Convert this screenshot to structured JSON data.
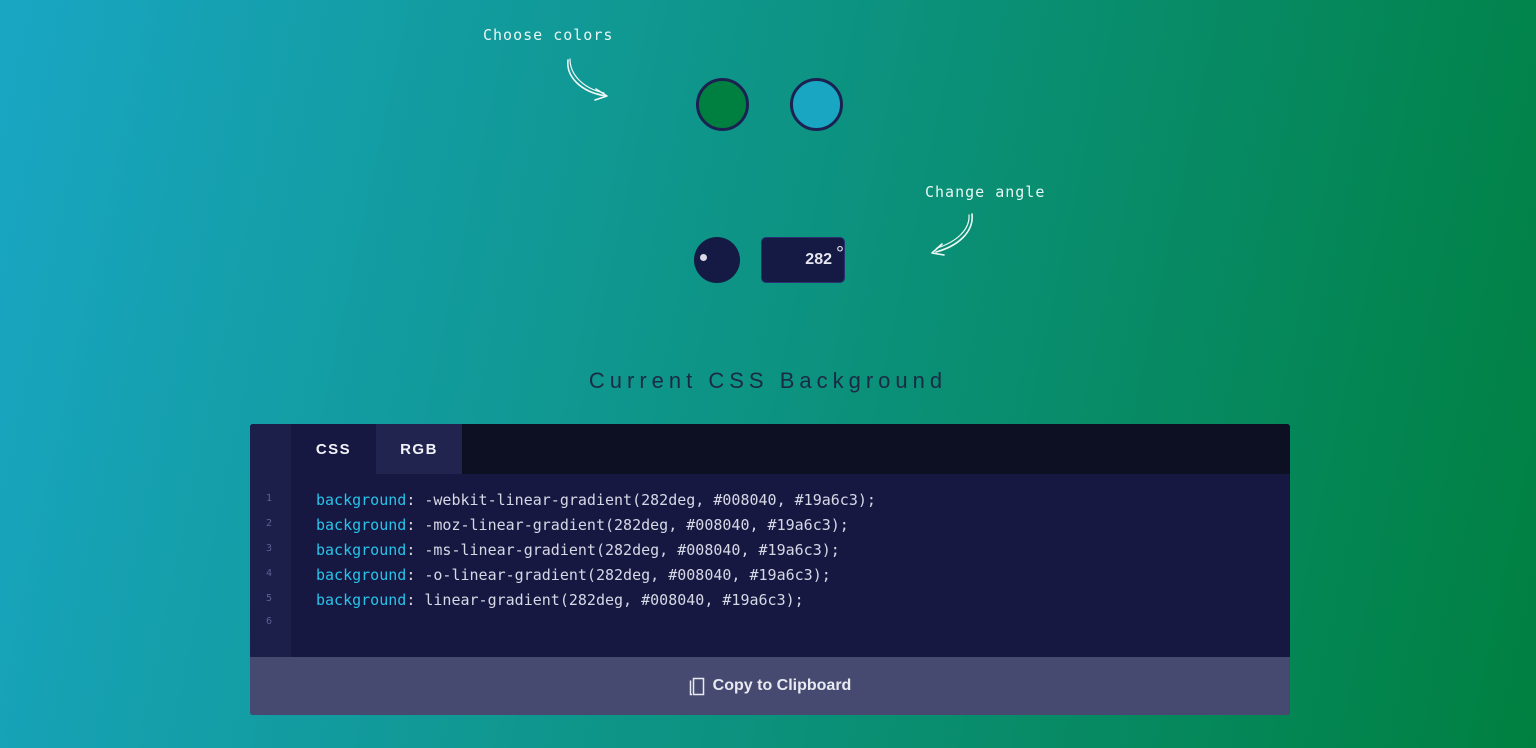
{
  "hints": {
    "choose_colors": "Choose colors",
    "change_angle": "Change angle"
  },
  "colors": {
    "first": "#008040",
    "second": "#19a6c3"
  },
  "angle": {
    "value": "282",
    "unit": "°"
  },
  "section_title": "Current CSS Background",
  "tabs": [
    {
      "label": "CSS",
      "active": true
    },
    {
      "label": "RGB",
      "active": false
    }
  ],
  "code": {
    "line_numbers": [
      "1",
      "2",
      "3",
      "4",
      "5",
      "6"
    ],
    "lines": [
      {
        "prop": "background",
        "value": ": -webkit-linear-gradient(282deg, #008040, #19a6c3);"
      },
      {
        "prop": "background",
        "value": ": -moz-linear-gradient(282deg, #008040, #19a6c3);"
      },
      {
        "prop": "background",
        "value": ": -ms-linear-gradient(282deg, #008040, #19a6c3);"
      },
      {
        "prop": "background",
        "value": ": -o-linear-gradient(282deg, #008040, #19a6c3);"
      },
      {
        "prop": "background",
        "value": ": linear-gradient(282deg, #008040, #19a6c3);"
      }
    ]
  },
  "copy_button": {
    "label": "Copy to Clipboard",
    "icon": "copy-icon"
  },
  "theme": {
    "panel_bg": "#161841",
    "property_color": "#29c3ea",
    "copy_bar_bg": "#474a70"
  }
}
